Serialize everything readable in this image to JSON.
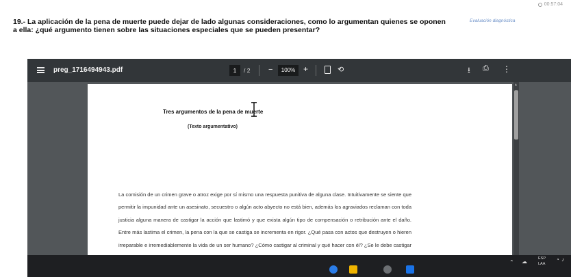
{
  "timer": "00:57:04",
  "question": {
    "text": "19.- La aplicación de la pena de muerte puede dejar de lado algunas consideraciones, como lo argumentan quienes se oponen a ella: ¿qué argumento tienen sobre las situaciones especiales que se pueden presentar?",
    "badge": "Evaluación diagnóstica"
  },
  "viewer": {
    "file_name": "preg_1716494943.pdf",
    "current_page": "1",
    "total_pages": "/ 2",
    "zoom_minus": "−",
    "zoom": "100%",
    "zoom_plus": "+"
  },
  "document": {
    "title": "Tres argumentos de la pena de muerte",
    "subtitle": "(Texto argumentativo)",
    "body": "La comisión de un crimen grave o atroz exige por sí mismo una respuesta punitiva de alguna clase. Intuitivamente se siente que permitir la impunidad ante un asesinato, secuestro o algún acto abyecto no está bien, además los agraviados reclaman con toda justicia alguna manera de castigar la acción que lastimó y que exista algún tipo de compensación o retribución ante el daño. Entre más lastima el crimen, la pena con la que se castiga se incrementa en rigor. ¿Qué pasa con actos que destruyen o hieren irreparable e irremediablemente la vida de un ser humano? ¿Cómo castigar al criminal y qué hacer con él? ¿Se le debe castigar con la misma acción que cometió?"
  },
  "taskbar": {
    "lang_primary": "ESP",
    "lang_secondary": "LAA"
  }
}
